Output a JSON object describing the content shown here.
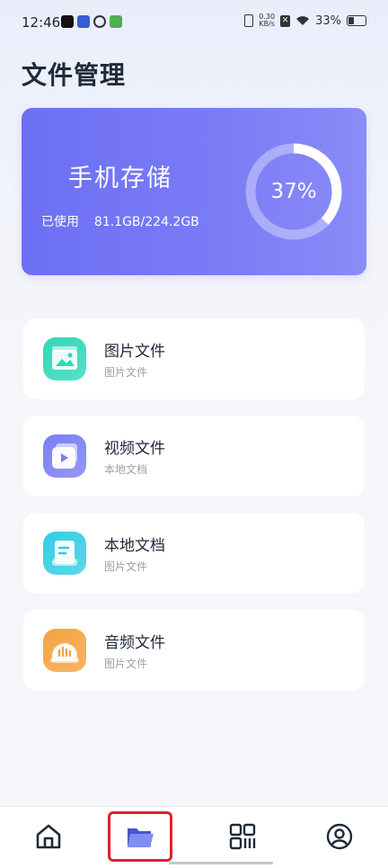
{
  "status_bar": {
    "time": "12:46",
    "net_speed_value": "0.30",
    "net_speed_unit": "KB/s",
    "battery": "33%"
  },
  "page": {
    "title": "文件管理"
  },
  "storage": {
    "title": "手机存储",
    "used_label": "已使用",
    "used_value": "81.1GB/224.2GB",
    "percent_text": "37%",
    "percent": 0.37
  },
  "file_categories": [
    {
      "title": "图片文件",
      "subtitle": "图片文件",
      "icon": "image-icon",
      "color": "#2fd8b6"
    },
    {
      "title": "视频文件",
      "subtitle": "本地文档",
      "icon": "video-icon",
      "color": "#7a7ef3"
    },
    {
      "title": "本地文档",
      "subtitle": "图片文件",
      "icon": "document-icon",
      "color": "#33cde4"
    },
    {
      "title": "音频文件",
      "subtitle": "图片文件",
      "icon": "audio-icon",
      "color": "#f5a240"
    }
  ],
  "bottom_nav": {
    "items": [
      {
        "icon": "home-icon"
      },
      {
        "icon": "folder-icon",
        "active": true
      },
      {
        "icon": "apps-grid-icon"
      },
      {
        "icon": "profile-icon"
      }
    ]
  }
}
